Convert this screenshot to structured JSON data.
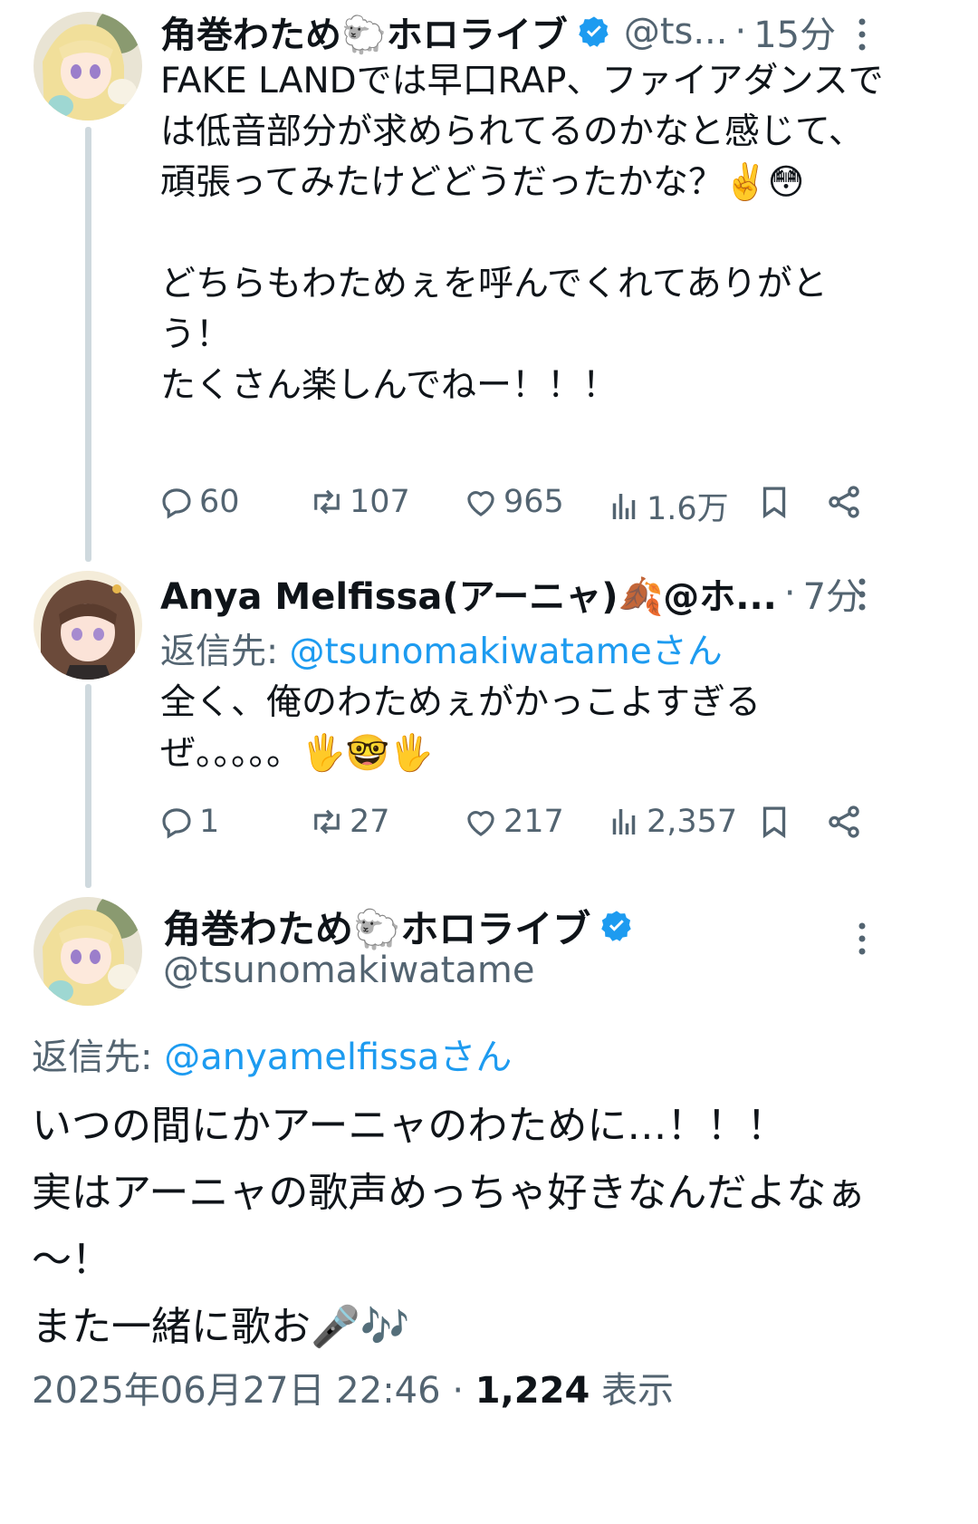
{
  "colors": {
    "accent": "#1d9bf0",
    "text": "#0f1419",
    "secondary": "#536471",
    "thread_line": "#cfd9de"
  },
  "tweets": [
    {
      "name": "角巻わため🐑ホロライブ",
      "verified": true,
      "handle": "@ts...",
      "time": "15分",
      "text": "FAKE LANDでは早口RAP、ファイアダンスでは低音部分が求められてるのかなと感じて、頑張ってみたけどどうだったかな？✌️😳\n\nどちらもわためぇを呼んでくれてありがとう！\nたくさん楽しんでねー！！！",
      "replies": "60",
      "retweets": "107",
      "likes": "965",
      "views": "1.6万",
      "icons": [
        "reply-icon",
        "retweet-icon",
        "like-icon",
        "views-icon",
        "bookmark-icon",
        "share-icon",
        "more-icon"
      ]
    },
    {
      "name": "Anya Melfissa(アーニャ)🍂@ホ...",
      "verified": false,
      "time": "7分",
      "reply_to_label": "返信先: ",
      "reply_to_user": "@tsunomakiwatameさん",
      "text": "全く、俺のわためぇがかっこよすぎるぜ。。。。。🖐️🤓🖐️",
      "replies": "1",
      "retweets": "27",
      "likes": "217",
      "views": "2,357"
    }
  ],
  "focus_tweet": {
    "name": "角巻わため🐑ホロライブ",
    "verified": true,
    "handle": "@tsunomakiwatame",
    "reply_to_label": "返信先: ",
    "reply_to_user": "@anyamelfissaさん",
    "text": "いつの間にかアーニャのわために…！！！\n実はアーニャの歌声めっちゃ好きなんだよなぁ～！\nまた一緒に歌お🎤🎶",
    "date": "2025年06月27日 22:46",
    "separator": "·",
    "views_count": "1,224",
    "views_label": "表示"
  }
}
